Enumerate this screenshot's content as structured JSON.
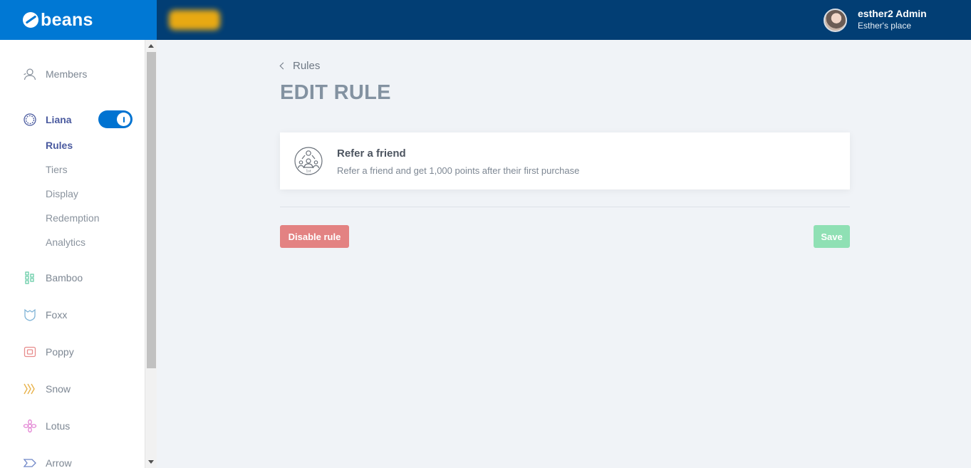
{
  "brand": {
    "name": "beans"
  },
  "user": {
    "name": "esther2 Admin",
    "place": "Esther's place"
  },
  "sidebar": {
    "members_label": "Members",
    "liana": {
      "label": "Liana",
      "enabled": true
    },
    "liana_sub": [
      "Rules",
      "Tiers",
      "Display",
      "Redemption",
      "Analytics"
    ],
    "apps": [
      {
        "label": "Bamboo",
        "icon": "bamboo-icon",
        "color": "#5cc9a0"
      },
      {
        "label": "Foxx",
        "icon": "foxx-icon",
        "color": "#7fb3d6"
      },
      {
        "label": "Poppy",
        "icon": "poppy-icon",
        "color": "#e78c8c"
      },
      {
        "label": "Snow",
        "icon": "snow-icon",
        "color": "#e8b24a"
      },
      {
        "label": "Lotus",
        "icon": "lotus-icon",
        "color": "#e07ad0"
      },
      {
        "label": "Arrow",
        "icon": "arrow-icon",
        "color": "#6f86c7"
      }
    ]
  },
  "breadcrumb": {
    "label": "Rules"
  },
  "page": {
    "title": "EDIT RULE"
  },
  "rule": {
    "title": "Refer a friend",
    "description": "Refer a friend and get 1,000 points after their first purchase",
    "icon": "refer-friend-icon"
  },
  "actions": {
    "disable_label": "Disable rule",
    "save_label": "Save"
  },
  "colors": {
    "topbar": "#023e74",
    "brand": "#0078d4",
    "accent": "#4a5a9f",
    "danger": "#e38282",
    "success": "#8fe0b4"
  }
}
